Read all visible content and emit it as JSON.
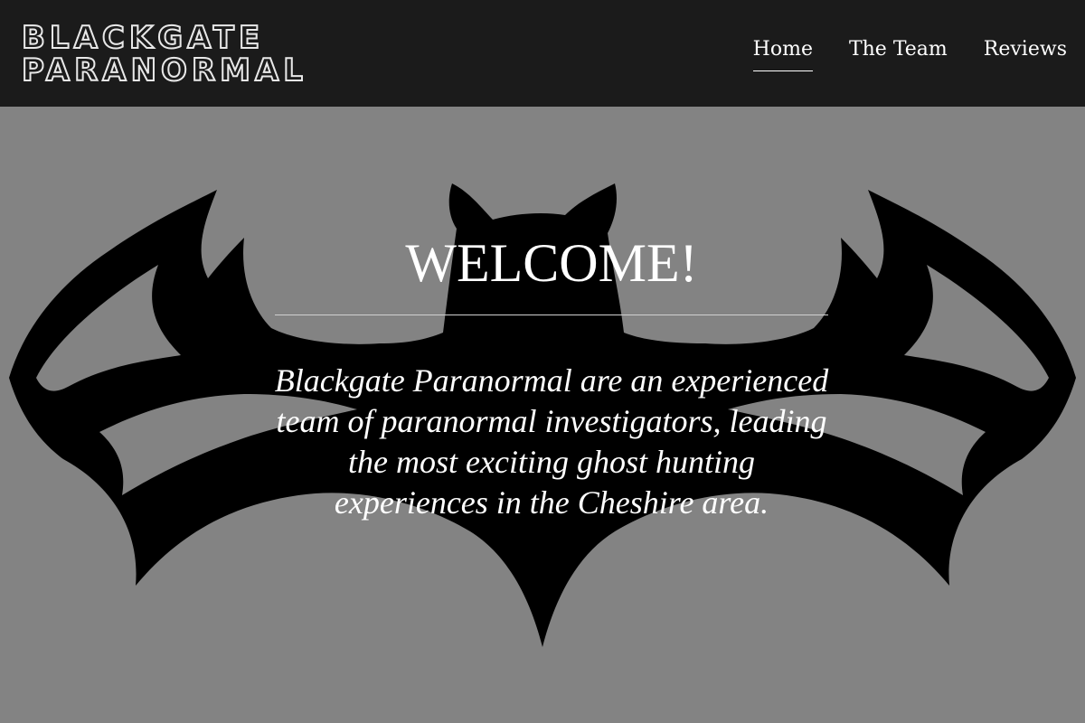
{
  "header": {
    "logo_line1": "BLACKGATE",
    "logo_line2": "PARANORMAL",
    "nav": [
      {
        "label": "Home",
        "active": true
      },
      {
        "label": "The Team",
        "active": false
      },
      {
        "label": "Reviews",
        "active": false
      }
    ]
  },
  "hero": {
    "title": "WELCOME!",
    "intro": "Blackgate Paranormal are an experienced team of paranormal investigators, leading the most exciting ghost hunting experiences in the Cheshire area.",
    "background_graphic": "bat-silhouette"
  },
  "colors": {
    "header_bg": "#1b1b1b",
    "hero_bg": "#838383",
    "text": "#ffffff",
    "bat": "#000000"
  }
}
